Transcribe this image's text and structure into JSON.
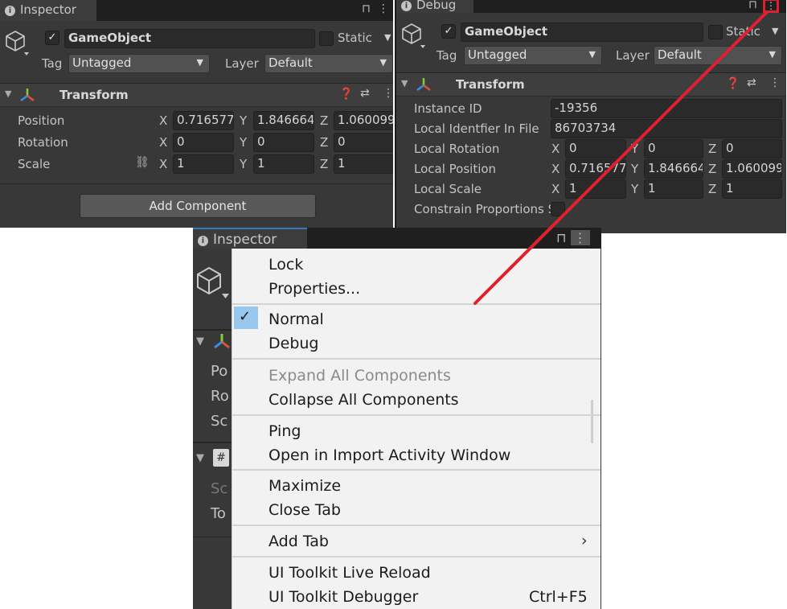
{
  "inspector_top": {
    "tab_label": "Inspector",
    "object_name": "GameObject",
    "static_label": "Static",
    "tag_label": "Tag",
    "tag_value": "Untagged",
    "layer_label": "Layer",
    "layer_value": "Default",
    "transform_title": "Transform",
    "rows": [
      {
        "label": "Position",
        "x": "0.716577",
        "y": "1.846664",
        "z": "1.060099"
      },
      {
        "label": "Rotation",
        "x": "0",
        "y": "0",
        "z": "0"
      },
      {
        "label": "Scale",
        "x": "1",
        "y": "1",
        "z": "1"
      }
    ],
    "axis_x": "X",
    "axis_y": "Y",
    "axis_z": "Z",
    "add_component": "Add Component"
  },
  "debug_panel": {
    "tab_label": "Debug",
    "object_name": "GameObject",
    "static_label": "Static",
    "tag_label": "Tag",
    "tag_value": "Untagged",
    "layer_label": "Layer",
    "layer_value": "Default",
    "transform_title": "Transform",
    "instance_id_label": "Instance ID",
    "instance_id_value": "-19356",
    "local_identifier_label": "Local Identfier In File",
    "local_identifier_value": "86703734",
    "local_rotation_label": "Local Rotation",
    "local_rotation": {
      "x": "0",
      "y": "0",
      "z": "0"
    },
    "local_position_label": "Local Position",
    "local_position": {
      "x": "0.716577",
      "y": "1.846664",
      "z": "1.060099"
    },
    "local_scale_label": "Local Scale",
    "local_scale": {
      "x": "1",
      "y": "1",
      "z": "1"
    },
    "constrain_label": "Constrain Proportions S",
    "axis_x": "X",
    "axis_y": "Y",
    "axis_z": "Z"
  },
  "inspector_bottom": {
    "tab_label": "Inspector",
    "partial_labels": [
      "Po",
      "Ro",
      "Sc",
      "Sc",
      "To"
    ]
  },
  "context_menu": {
    "lock": "Lock",
    "properties": "Properties...",
    "normal": "Normal",
    "debug": "Debug",
    "expand_all": "Expand All Components",
    "collapse_all": "Collapse All Components",
    "ping": "Ping",
    "open_import": "Open in Import Activity Window",
    "maximize": "Maximize",
    "close_tab": "Close Tab",
    "add_tab": "Add Tab",
    "live_reload": "UI Toolkit Live Reload",
    "debugger": "UI Toolkit Debugger",
    "debugger_shortcut": "Ctrl+F5",
    "selected_item": "Normal"
  },
  "colors": {
    "panel_bg": "#383838",
    "menu_bg": "#f2f2f2",
    "annotation": "#e02030",
    "check_highlight": "#99c8ee"
  }
}
